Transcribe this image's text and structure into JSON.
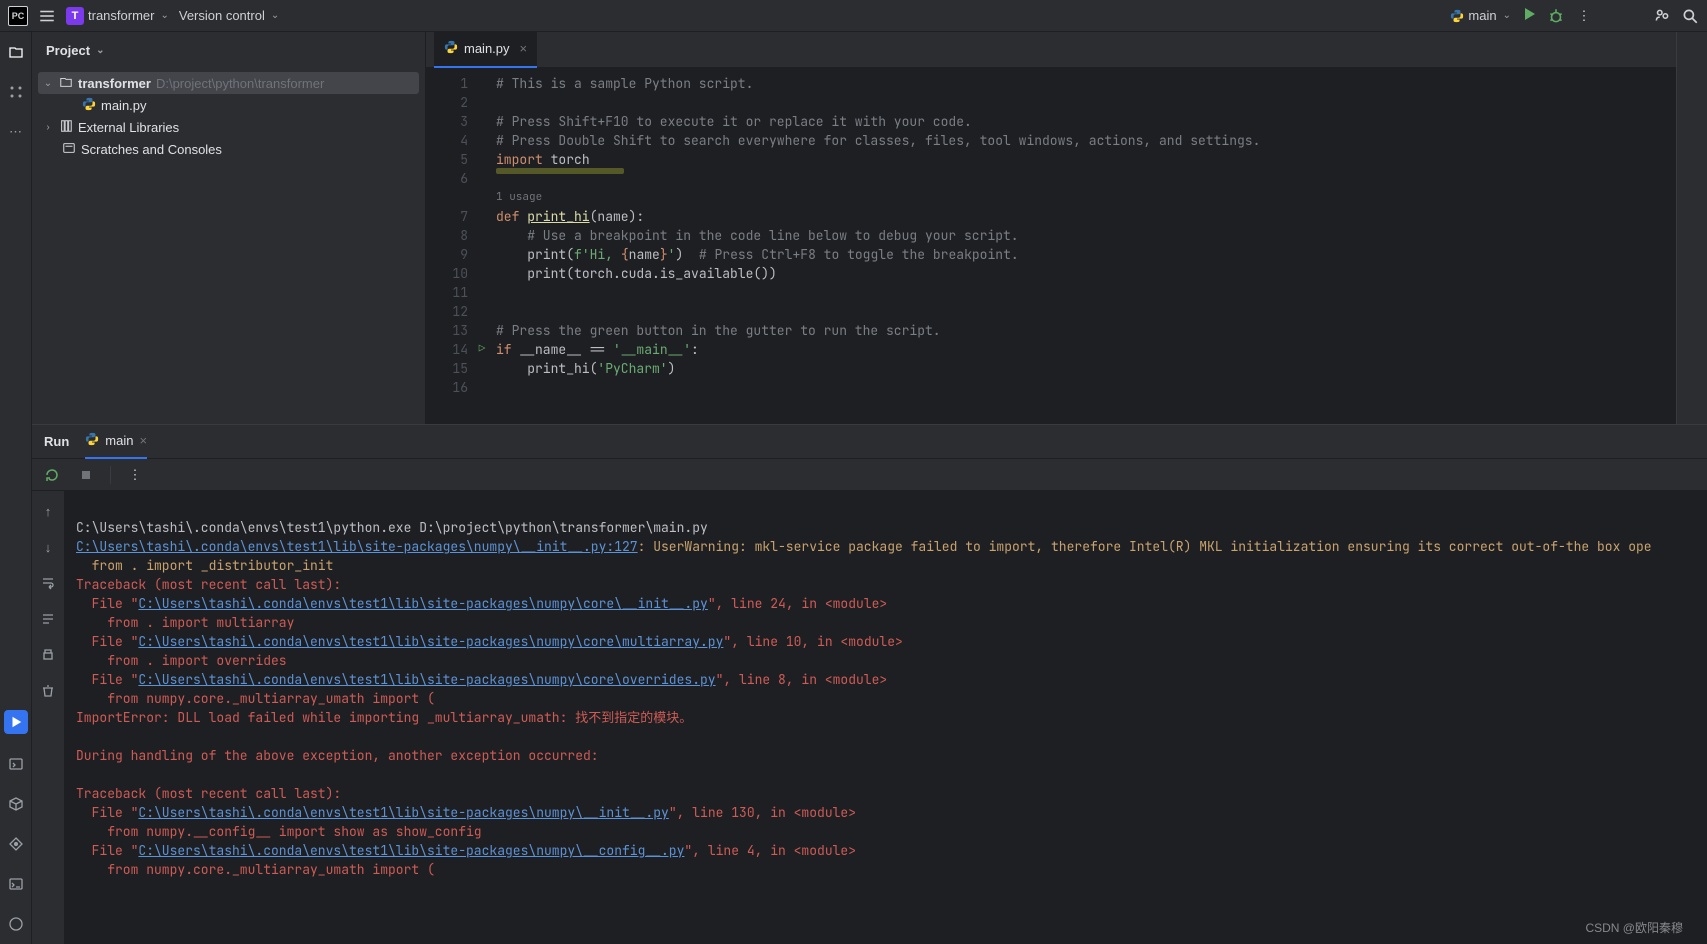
{
  "titlebar": {
    "project_letter": "T",
    "project_name": "transformer",
    "version_control": "Version control",
    "run_config": "main"
  },
  "project_panel": {
    "title": "Project",
    "root": {
      "name": "transformer",
      "path": "D:\\project\\python\\transformer"
    },
    "file": "main.py",
    "ext_libs": "External Libraries",
    "scratches": "Scratches and Consoles"
  },
  "editor": {
    "tab": "main.py",
    "usage": "1 usage",
    "line_numbers": [
      "1",
      "2",
      "3",
      "4",
      "5",
      "6",
      "",
      "7",
      "8",
      "9",
      "10",
      "11",
      "12",
      "13",
      "14",
      "15",
      "16"
    ],
    "code": {
      "l1": "# This is a sample Python script.",
      "l3": "# Press Shift+F10 to execute it or replace it with your code.",
      "l4": "# Press Double Shift to search everywhere for classes, files, tool windows, actions, and settings.",
      "l5_import": "import",
      "l5_mod": " torch",
      "l7_def": "def ",
      "l7_name": "print_hi",
      "l7_rest": "(name):",
      "l8": "    # Use a breakpoint in the code line below to debug your script.",
      "l9_a": "    print(",
      "l9_b": "f'Hi, ",
      "l9_c": "{",
      "l9_d": "name",
      "l9_e": "}",
      "l9_f": "'",
      "l9_g": ")  ",
      "l9_h": "# Press Ctrl+F8 to toggle the breakpoint.",
      "l10_a": "    print(",
      "l10_b": "torch.cuda.is_available())",
      "l13": "# Press the green button in the gutter to run the script.",
      "l14_a": "if",
      "l14_b": " __name__ == ",
      "l14_c": "'__main__'",
      "l14_d": ":",
      "l15_a": "    print_hi(",
      "l15_b": "'PyCharm'",
      "l15_c": ")"
    }
  },
  "run_panel": {
    "title": "Run",
    "tab": "main"
  },
  "console": {
    "l1": "C:\\Users\\tashi\\.conda\\envs\\test1\\python.exe D:\\project\\python\\transformer\\main.py",
    "l2_link": "C:\\Users\\tashi\\.conda\\envs\\test1\\lib\\site-packages\\numpy\\__init__.py:127",
    "l2_rest": ": UserWarning: mkl-service package failed to import, therefore Intel(R) MKL initialization ensuring its correct out-of-the box ope",
    "l3": "  from . import _distributor_init",
    "l4": "Traceback (most recent call last):",
    "l5_a": "  File \"",
    "l5_link": "C:\\Users\\tashi\\.conda\\envs\\test1\\lib\\site-packages\\numpy\\core\\__init__.py",
    "l5_b": "\", line 24, in <module>",
    "l6": "    from . import multiarray",
    "l7_a": "  File \"",
    "l7_link": "C:\\Users\\tashi\\.conda\\envs\\test1\\lib\\site-packages\\numpy\\core\\multiarray.py",
    "l7_b": "\", line 10, in <module>",
    "l8": "    from . import overrides",
    "l9_a": "  File \"",
    "l9_link": "C:\\Users\\tashi\\.conda\\envs\\test1\\lib\\site-packages\\numpy\\core\\overrides.py",
    "l9_b": "\", line 8, in <module>",
    "l10": "    from numpy.core._multiarray_umath import (",
    "l11": "ImportError: DLL load failed while importing _multiarray_umath: 找不到指定的模块。",
    "l12": "",
    "l13": "During handling of the above exception, another exception occurred:",
    "l14": "",
    "l15": "Traceback (most recent call last):",
    "l16_a": "  File \"",
    "l16_link": "C:\\Users\\tashi\\.conda\\envs\\test1\\lib\\site-packages\\numpy\\__init__.py",
    "l16_b": "\", line 130, in <module>",
    "l17": "    from numpy.__config__ import show as show_config",
    "l18_a": "  File \"",
    "l18_link": "C:\\Users\\tashi\\.conda\\envs\\test1\\lib\\site-packages\\numpy\\__config__.py",
    "l18_b": "\", line 4, in <module>",
    "l19": "    from numpy.core._multiarray_umath import ("
  },
  "watermark": "CSDN @欧阳秦穆"
}
